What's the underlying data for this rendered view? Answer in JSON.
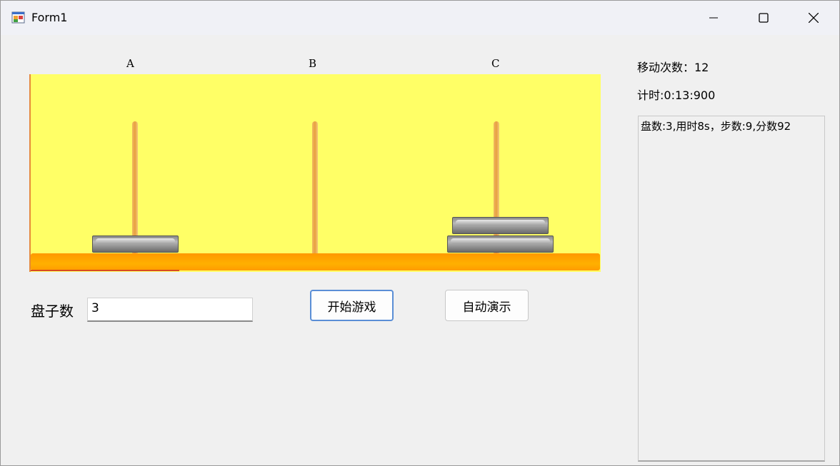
{
  "window": {
    "title": "Form1",
    "controls": {
      "minimize_icon": "minimize-icon",
      "maximize_icon": "maximize-icon",
      "close_icon": "close-icon"
    }
  },
  "game": {
    "peg_labels": [
      "A",
      "B",
      "C"
    ],
    "pegs": [
      {
        "label": "A",
        "disc_count": 1
      },
      {
        "label": "B",
        "disc_count": 0
      },
      {
        "label": "C",
        "disc_count": 2
      }
    ],
    "colors": {
      "board": "#ffff66",
      "base": "#ffa500",
      "disc": "#8a8a8a",
      "peg": "#e8a040"
    }
  },
  "controls": {
    "disk_count_label": "盘子数",
    "disk_count_value": "3",
    "start_button": "开始游戏",
    "auto_button": "自动演示"
  },
  "status": {
    "moves_text": "移动次数：12",
    "timer_text": "计时:0:13:900"
  },
  "log": {
    "entries": [
      "盘数:3,用时8s，步数:9,分数92"
    ]
  }
}
